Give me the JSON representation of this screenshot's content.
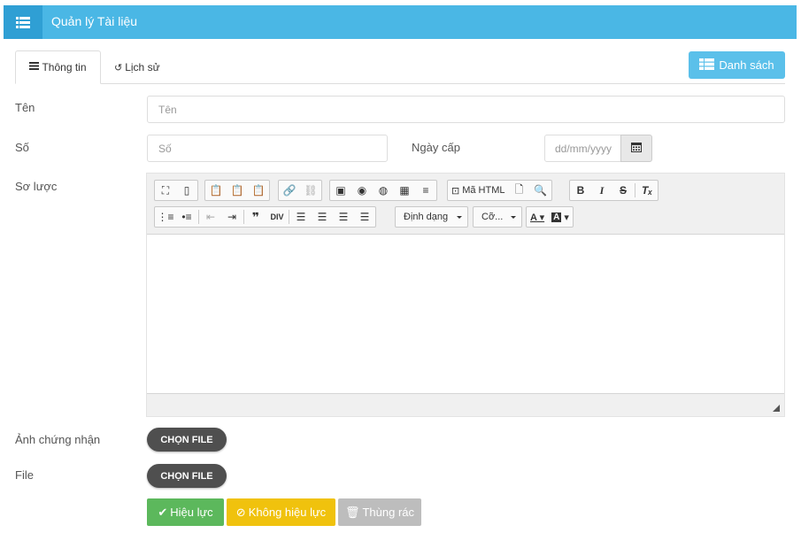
{
  "header": {
    "title": "Quản lý Tài liệu",
    "menu_icon": "list-icon"
  },
  "tabs": [
    {
      "label": "Thông tin",
      "icon": "info-list-icon"
    },
    {
      "label": "Lịch sử",
      "icon": "history-icon"
    }
  ],
  "list_button": {
    "label": "Danh sách",
    "icon": "table-icon"
  },
  "form": {
    "name_label": "Tên",
    "name_placeholder": "Tên",
    "number_label": "Số",
    "number_placeholder": "Số",
    "date_label": "Ngày cấp",
    "date_placeholder": "dd/mm/yyyy",
    "summary_label": "Sơ lược",
    "cert_image_label": "Ảnh chứng nhận",
    "file_label": "File"
  },
  "editor": {
    "source_label": "Mã HTML",
    "format_label": "Định dạng",
    "size_label": "Cỡ..."
  },
  "file_buttons": {
    "cert": "CHỌN FILE",
    "file": "CHỌN FILE"
  },
  "actions": {
    "valid": "Hiệu lực",
    "invalid": "Không hiệu lực",
    "trash": "Thùng rác"
  },
  "colors": {
    "header": "#4ab7e5",
    "valid": "#5cb85c",
    "invalid": "#f0c20d",
    "trash": "#bdbdbd"
  }
}
